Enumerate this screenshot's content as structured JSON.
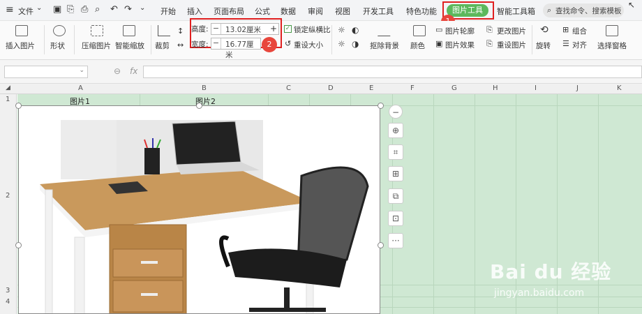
{
  "menu": {
    "hamburger": "≡",
    "file": "文件",
    "tabs": [
      "开始",
      "插入",
      "页面布局",
      "公式",
      "数据",
      "审阅",
      "视图",
      "开发工具",
      "特色功能"
    ],
    "active_tab": "图片工具",
    "smart_tab": "智能工具箱",
    "search_placeholder": "查找命令、搜索模板"
  },
  "ribbon": {
    "insert_picture": "插入图片",
    "shape": "形状",
    "compress": "压缩图片",
    "smart_scale": "智能缩放",
    "crop": "裁剪",
    "height_label": "高度:",
    "height_value": "13.02厘米",
    "width_label": "宽度:",
    "width_value": "16.77厘米",
    "minus": "−",
    "plus": "+",
    "lock_ratio": "锁定纵横比",
    "reset_size": "重设大小",
    "remove_bg": "抠除背景",
    "color": "颜色",
    "pic_outline": "图片轮廓",
    "pic_effect": "图片效果",
    "change_pic": "更改图片",
    "reset_pic": "重设图片",
    "rotate": "旋转",
    "group": "组合",
    "align": "对齐",
    "selection_pane": "选择窗格"
  },
  "annotations": {
    "badge1": "1",
    "badge2": "2"
  },
  "formula_bar": {
    "fx": "fx",
    "q": "⊖"
  },
  "sheet": {
    "columns": [
      "A",
      "B",
      "C",
      "D",
      "E",
      "F",
      "G",
      "H",
      "I",
      "J",
      "K"
    ],
    "rows": [
      "1",
      "2",
      "3",
      "4"
    ],
    "cell_a1": "图片1",
    "cell_b1": "图片2"
  },
  "float_toolbar": [
    "−",
    "⊕",
    "⌗",
    "⊞",
    "⧉",
    "⊡",
    "···"
  ],
  "watermark": {
    "logo": "Bai du 经验",
    "url": "jingyan.baidu.com"
  }
}
